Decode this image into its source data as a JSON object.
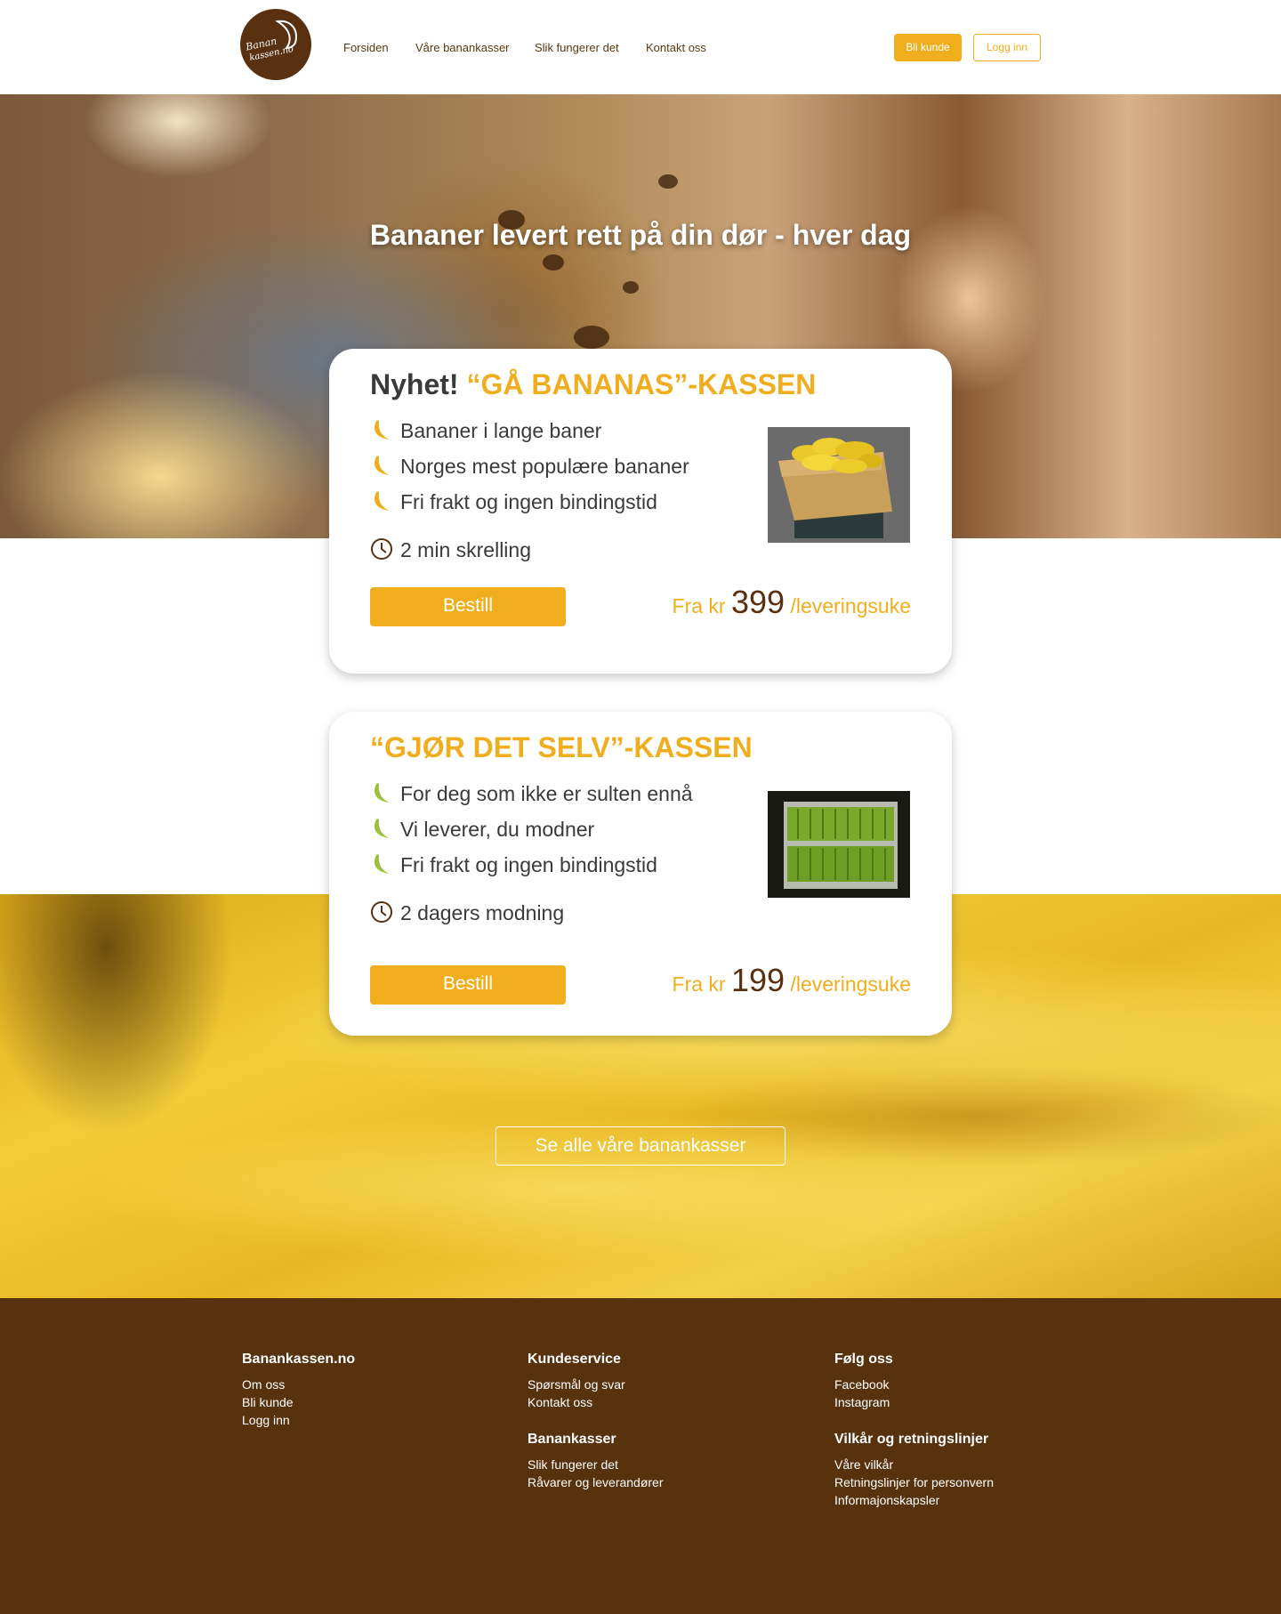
{
  "header": {
    "logo_line1": "Banan",
    "logo_line2": "kassen.no",
    "nav": [
      "Forsiden",
      "Våre banankasser",
      "Slik fungerer det",
      "Kontakt oss"
    ],
    "signup": "Bli kunde",
    "login": "Logg inn"
  },
  "hero": {
    "title": "Bananer levert rett på din dør - hver dag"
  },
  "cards": [
    {
      "lead": "Nyhet!",
      "name": "“GÅ BANANAS”-KASSEN",
      "features": [
        "Bananer i lange baner",
        "Norges mest populære bananer",
        "Fri frakt og ingen bindingstid"
      ],
      "time": "2 min skrelling",
      "button": "Bestill",
      "price_prefix": "Fra kr",
      "price": "399",
      "price_suffix": "/leveringsuke"
    },
    {
      "lead": "",
      "name": "“GJØR DET SELV”-KASSEN",
      "features": [
        "For deg som ikke er sulten ennå",
        "Vi leverer, du modner",
        "Fri frakt og ingen bindingstid"
      ],
      "time": "2 dagers modning",
      "button": "Bestill",
      "price_prefix": "Fra kr",
      "price": "199",
      "price_suffix": "/leveringsuke"
    }
  ],
  "see_all": "Se alle våre banankasser",
  "footer": {
    "col1": {
      "heading": "Banankassen.no",
      "links": [
        "Om oss",
        "Bli kunde",
        "Logg inn"
      ]
    },
    "col2": {
      "heading": "Kundeservice",
      "links": [
        "Spørsmål og svar",
        "Kontakt oss"
      ]
    },
    "col3": {
      "heading": "Banankasser",
      "links": [
        "Slik fungerer det",
        "Råvarer og leverandører"
      ]
    },
    "col4": {
      "heading": "Følg oss",
      "links": [
        "Facebook",
        "Instagram"
      ]
    },
    "col5": {
      "heading": "Vilkår og retningslinjer",
      "links": [
        "Våre vilkår",
        "Retningslinjer for personvern",
        "Informajonskapsler"
      ]
    }
  },
  "colors": {
    "accent": "#f0ae1e",
    "brown": "#58310d",
    "green": "#9dbf3a"
  }
}
